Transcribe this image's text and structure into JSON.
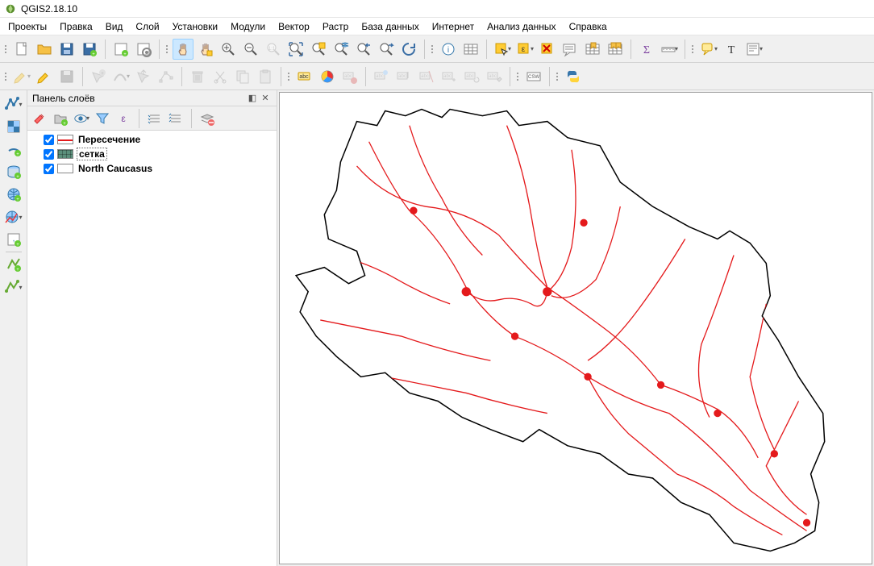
{
  "app": {
    "title": "QGIS2.18.10"
  },
  "menu": {
    "items": [
      "Проекты",
      "Правка",
      "Вид",
      "Слой",
      "Установки",
      "Модули",
      "Вектор",
      "Растр",
      "База данных",
      "Интернет",
      "Анализ данных",
      "Справка"
    ]
  },
  "layers_panel": {
    "title": "Панель слоёв",
    "items": [
      {
        "checked": true,
        "label": "Пересечение",
        "symbol_type": "line",
        "symbol_color": "#e41a1c",
        "selected": false
      },
      {
        "checked": true,
        "label": "сетка",
        "symbol_type": "grid",
        "symbol_color": "#5b8f7b",
        "selected": true
      },
      {
        "checked": true,
        "label": "North Caucasus",
        "symbol_type": "fill",
        "symbol_color": "#ffffff",
        "selected": false
      }
    ]
  },
  "map": {
    "region_name": "North Caucasus",
    "fill_color": "#5b8f7b",
    "grid_color": "#000000",
    "roads_color": "#e41a1c"
  },
  "icons": {
    "new": "new-project",
    "open": "open",
    "save": "save",
    "saveas": "save-as",
    "newprint": "new-print",
    "composer": "composer-manager",
    "pan": "pan",
    "pan_to": "pan-to-selection",
    "zoom_in": "zoom-in",
    "zoom_out": "zoom-out",
    "zoom_native": "zoom-native",
    "zoom_full": "zoom-full",
    "zoom_sel": "zoom-to-selection",
    "zoom_layer": "zoom-to-layer",
    "zoom_last": "zoom-last",
    "zoom_next": "zoom-next",
    "refresh": "refresh",
    "identify": "identify",
    "query": "query",
    "select": "select",
    "deselect": "deselect",
    "tips": "map-tips",
    "bookmarks": "bookmarks",
    "newbm": "new-bookmark",
    "measure": "measure",
    "sum": "statistics",
    "scale": "scalebar",
    "label": "text-annotation",
    "ann": "annotation",
    "edit_toggle": "toggle-editing",
    "edit_save": "save-edits",
    "add_feat": "add-feature",
    "move_feat": "move-feature",
    "node": "node-tool",
    "delete": "delete-selected",
    "cut": "cut-features",
    "copy": "copy-features",
    "paste": "paste-features",
    "labeling": "labeling",
    "diagram": "diagram",
    "label_rule": "label-rule",
    "label_pin": "pin-labels",
    "label_showhide": "show-hide-labels",
    "label_move": "move-label",
    "label_rotate": "rotate-label",
    "label_change": "change-label",
    "csw": "csw",
    "python": "python-console",
    "add_vector": "add-vector",
    "add_raster": "add-raster",
    "add_spatialite": "add-spatialite",
    "add_postgis": "add-postgis",
    "add_wms": "add-wms",
    "add_wcs": "add-wcs",
    "add_wfs": "add-wfs",
    "add_csv": "add-csv",
    "add_virtual": "add-virtual",
    "new_shapefile": "new-shapefile",
    "new_spatialite": "new-spatialite-layer",
    "style": "style-manager",
    "eye": "manage-visibility",
    "filter": "filter-legend",
    "expr": "filter-by-expression",
    "expand": "expand-all",
    "collapse": "collapse-all",
    "remove": "remove-layer",
    "presets": "presets"
  }
}
